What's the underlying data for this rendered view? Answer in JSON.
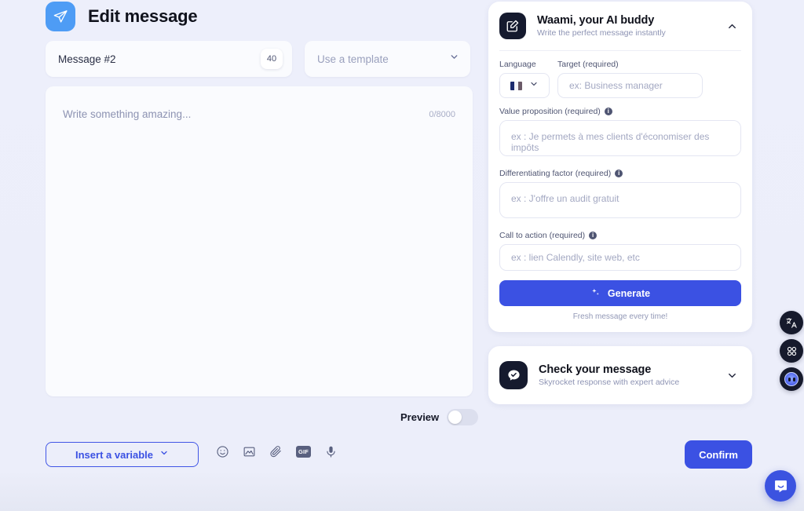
{
  "header": {
    "title": "Edit message",
    "icon": "send-icon"
  },
  "message": {
    "name_value": "Message #2",
    "name_badge": "40",
    "template_placeholder": "Use a template",
    "editor_placeholder": "Write something amazing...",
    "editor_counter": "0/8000"
  },
  "preview": {
    "label": "Preview",
    "enabled": false
  },
  "toolbar": {
    "insert_variable_label": "Insert a variable",
    "confirm_label": "Confirm",
    "icons": [
      {
        "name": "emoji-icon",
        "glyph": "smiley"
      },
      {
        "name": "image-icon",
        "glyph": "picture"
      },
      {
        "name": "attachment-icon",
        "glyph": "paperclip"
      },
      {
        "name": "gif-icon",
        "glyph": "GIF"
      },
      {
        "name": "voice-record-icon",
        "glyph": "microphone"
      }
    ]
  },
  "assistant": {
    "title": "Waami, your AI buddy",
    "subtitle": "Write the perfect message instantly",
    "expanded": true,
    "fields": {
      "language_label": "Language",
      "language_flag": "fr",
      "target_label": "Target (required)",
      "target_placeholder": "ex: Business manager",
      "value_label": "Value proposition (required)",
      "value_placeholder": "ex : Je permets à mes clients d'économiser des impôts",
      "differentiating_label": "Differentiating factor (required)",
      "differentiating_placeholder": "ex : J'offre un audit gratuit",
      "cta_label": "Call to action (required)",
      "cta_placeholder": "ex : lien Calendly, site web, etc"
    },
    "generate_label": "Generate",
    "generate_note": "Fresh message every time!"
  },
  "checker": {
    "title": "Check your message",
    "subtitle": "Skyrocket response with expert advice",
    "expanded": false
  },
  "float_buttons": [
    {
      "name": "translate-icon"
    },
    {
      "name": "apps-grid-icon"
    },
    {
      "name": "assistant-avatar-icon"
    }
  ],
  "support": {
    "launcher": "intercom-chat-icon"
  },
  "colors": {
    "accent": "#3b51e3",
    "header_icon": "#4e9cf5",
    "background": "#eceefa",
    "card": "#ffffff",
    "dark": "#151a2e"
  }
}
